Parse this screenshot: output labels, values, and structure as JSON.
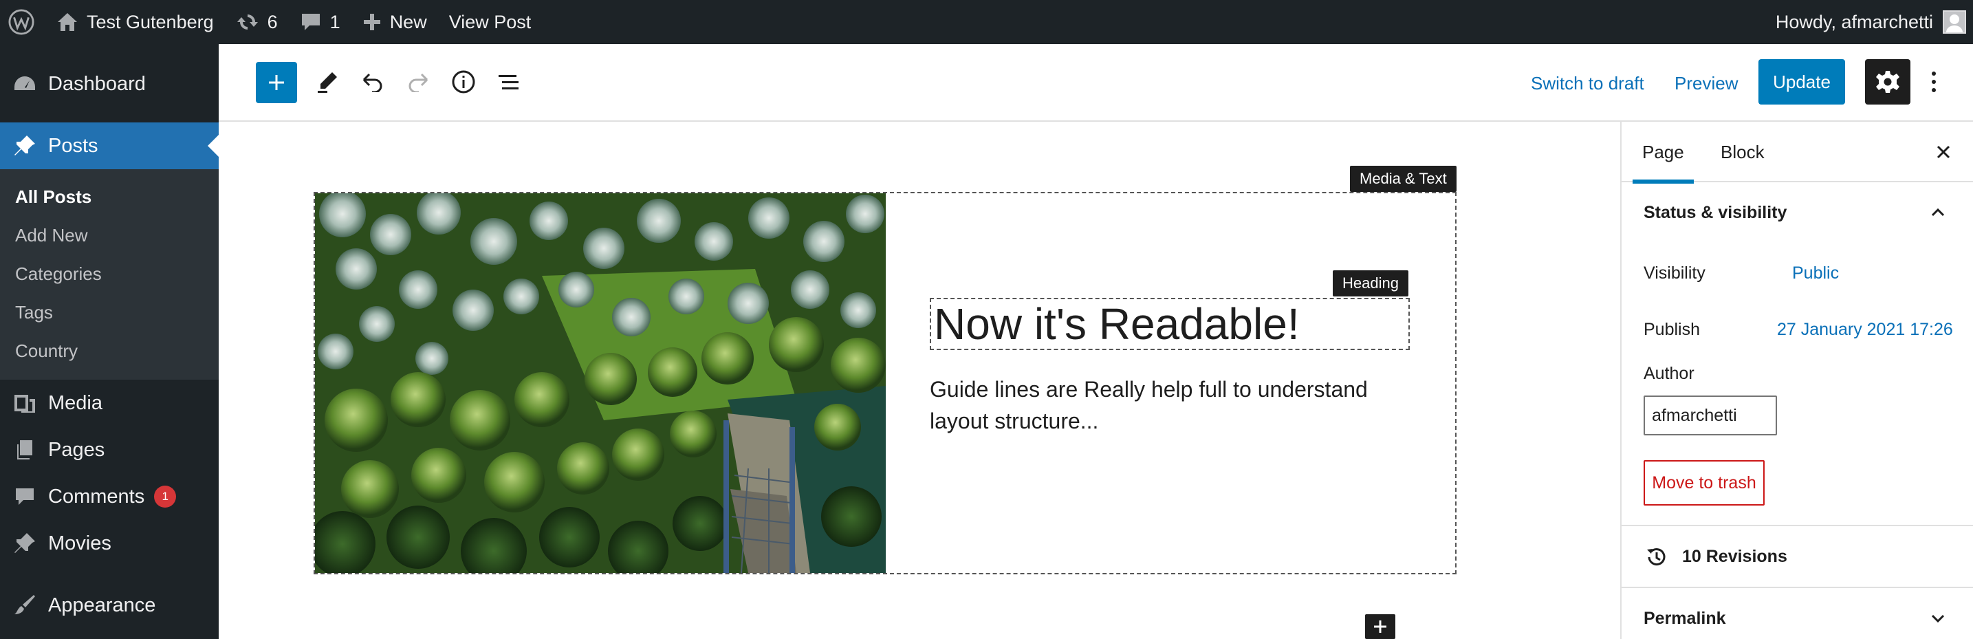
{
  "admin_bar": {
    "site_name": "Test Gutenberg",
    "updates_count": "6",
    "comments_count": "1",
    "new_label": "New",
    "view_post_label": "View Post",
    "howdy": "Howdy, afmarchetti"
  },
  "menu": {
    "dashboard": "Dashboard",
    "posts": "Posts",
    "posts_submenu": [
      "All Posts",
      "Add New",
      "Categories",
      "Tags",
      "Country"
    ],
    "media": "Media",
    "pages": "Pages",
    "comments": "Comments",
    "comments_badge": "1",
    "movies": "Movies",
    "appearance": "Appearance"
  },
  "header": {
    "switch_to_draft": "Switch to draft",
    "preview": "Preview",
    "update": "Update"
  },
  "canvas": {
    "media_text_label": "Media & Text",
    "heading_label": "Heading",
    "heading": "Now it's Readable!",
    "paragraph": "Guide lines are Really help full to understand layout structure..."
  },
  "sidebar": {
    "tabs": [
      "Page",
      "Block"
    ],
    "status_panel_title": "Status & visibility",
    "visibility_label": "Visibility",
    "visibility_value": "Public",
    "publish_label": "Publish",
    "publish_value": "27 January 2021 17:26",
    "author_label": "Author",
    "author_value": "afmarchetti",
    "move_to_trash": "Move to trash",
    "revisions": "10 Revisions",
    "permalink": "Permalink"
  },
  "colors": {
    "admin_dark": "#1d2327",
    "accent_blue": "#007cba",
    "link_blue": "#0a70b8",
    "danger_red": "#cc1818",
    "badge_orange": "#d63638"
  }
}
